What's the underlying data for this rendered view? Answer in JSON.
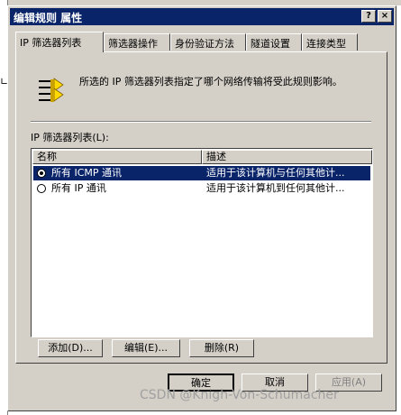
{
  "dialog": {
    "title": "编辑规则 属性",
    "help_glyph": "?",
    "close_glyph": "×"
  },
  "tabs": [
    {
      "label": "IP 筛选器列表",
      "active": true
    },
    {
      "label": "筛选器操作"
    },
    {
      "label": "身份验证方法"
    },
    {
      "label": "隧道设置"
    },
    {
      "label": "连接类型"
    }
  ],
  "panel": {
    "description": "所选的 IP 筛选器列表指定了哪个网络传输将受此规则影响。",
    "list_label": "IP 筛选器列表(L):"
  },
  "list": {
    "columns": [
      "名称",
      "描述"
    ],
    "rows": [
      {
        "name": "所有 ICMP 通讯",
        "description": "适用于该计算机与任何其他计...",
        "checked": true,
        "selected": true
      },
      {
        "name": "所有 IP 通讯",
        "description": "适用于该计算机到任何其他计...",
        "checked": false,
        "selected": false
      }
    ]
  },
  "buttons": {
    "add": "添加(D)...",
    "edit": "编辑(E)...",
    "remove": "删除(R)",
    "ok": "确定",
    "cancel": "取消",
    "apply": "应用(A)"
  },
  "background": {
    "left_mark": "∟"
  },
  "watermark": "CSDN @Knigh-Von-Schumacher",
  "colors": {
    "face": "#d4d0c8",
    "titlebar": "#0a246a",
    "selection": "#0a246a",
    "disabled_text": "#808080"
  }
}
